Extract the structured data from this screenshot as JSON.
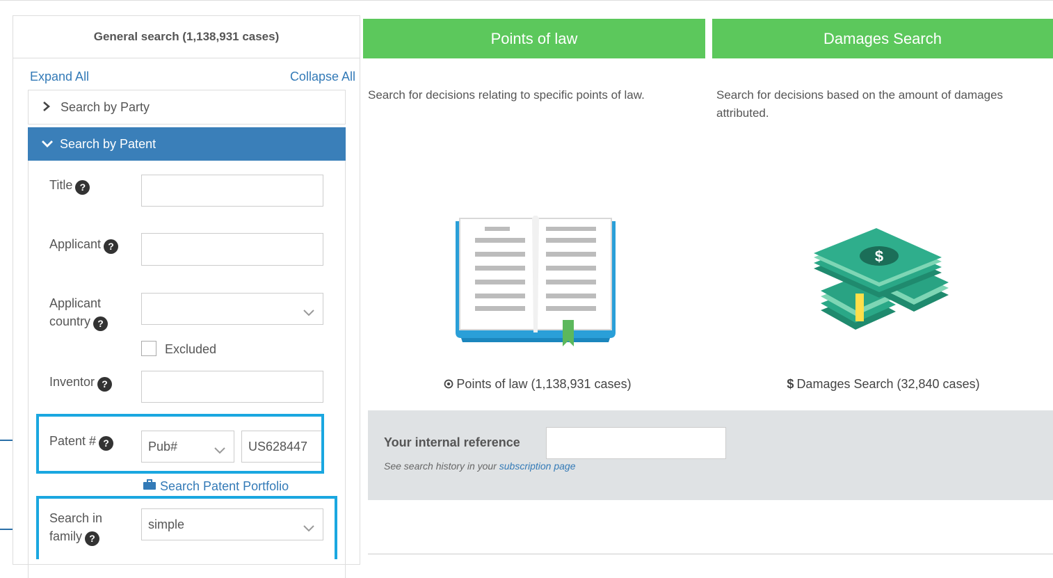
{
  "left_panel": {
    "header": "General search (1,138,931 cases)",
    "expand_all": "Expand All",
    "collapse_all": "Collapse All",
    "accordions": {
      "party": "Search by Party",
      "patent": "Search by Patent"
    },
    "fields": {
      "title": {
        "label": "Title",
        "value": ""
      },
      "applicant": {
        "label": "Applicant",
        "value": ""
      },
      "applicant_country": {
        "label_line1": "Applicant",
        "label_line2": "country",
        "value": "",
        "excluded_label": "Excluded"
      },
      "inventor": {
        "label": "Inventor",
        "value": ""
      },
      "patent_number": {
        "label": "Patent #",
        "type_value": "Pub#",
        "value": "US628447",
        "portfolio_link": "Search Patent Portfolio"
      },
      "search_in_family": {
        "label_line1": "Search in",
        "label_line2": "family",
        "value": "simple"
      }
    },
    "help_glyph": "?"
  },
  "points_of_law": {
    "tab_label": "Points of law",
    "description": "Search for decisions relating to specific points of law.",
    "link_label": "Points of law (1,138,931 cases)",
    "icon": "open-book-icon"
  },
  "damages": {
    "tab_label": "Damages Search",
    "description": "Search for decisions based on the amount of damages attributed.",
    "link_label": "Damages Search (32,840 cases)",
    "currency_symbol": "$",
    "icon": "money-stack-icon"
  },
  "reference": {
    "label": "Your internal reference",
    "value": "",
    "note_prefix": "See search history in your ",
    "note_link": "subscription page"
  },
  "colors": {
    "green_tab": "#5cc85c",
    "accordion_active": "#3a7fb9",
    "link": "#337ab7",
    "highlight": "#1aa7e0"
  }
}
